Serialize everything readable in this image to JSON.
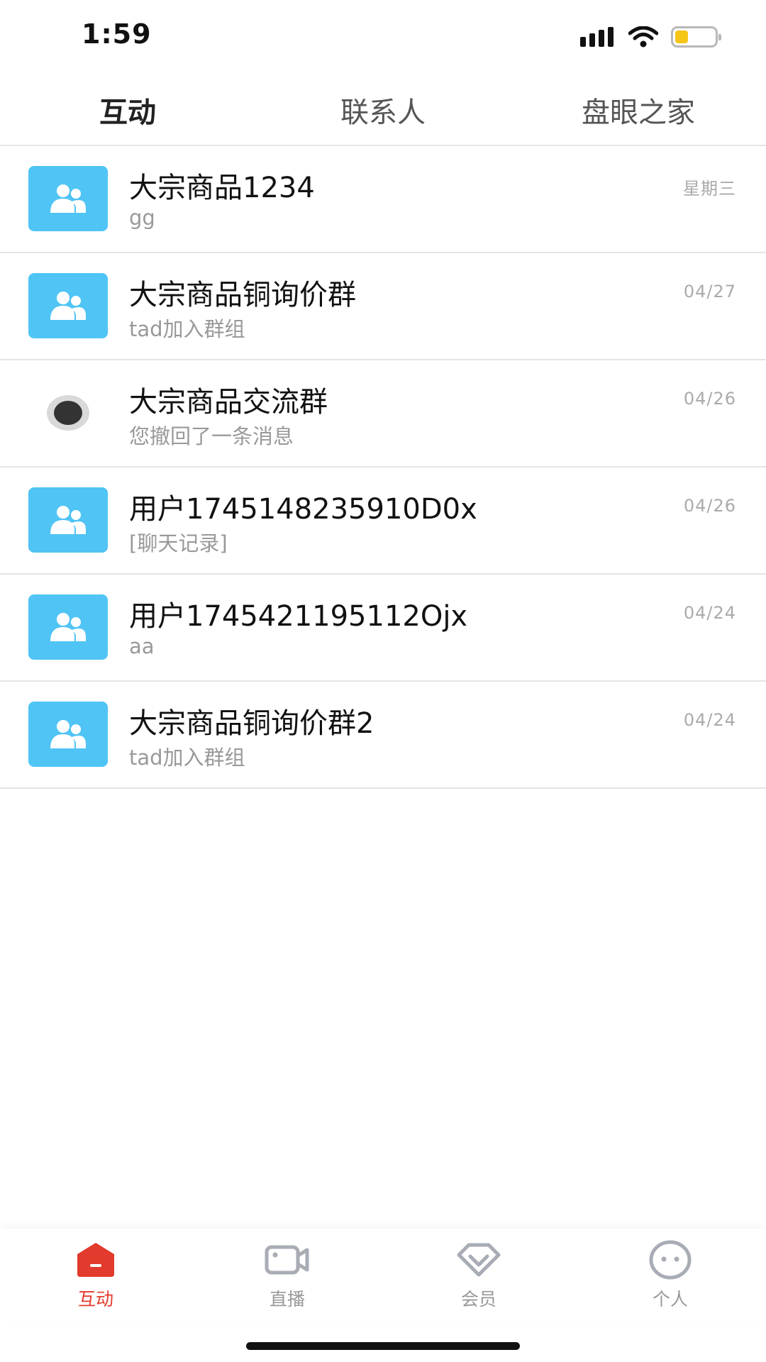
{
  "status_bar": {
    "time": "1:59",
    "battery_level": 0.3,
    "battery_color": "#f5c518"
  },
  "top_tabs": [
    {
      "label": "互动",
      "active": true
    },
    {
      "label": "联系人",
      "active": false
    },
    {
      "label": "盘眼之家",
      "active": false
    }
  ],
  "conversations": [
    {
      "name": "大宗商品1234",
      "preview": "gg",
      "date": "星期三",
      "avatar": "group-icon"
    },
    {
      "name": "大宗商品铜询价群",
      "preview": "tad加入群组",
      "date": "04/27",
      "avatar": "group-icon"
    },
    {
      "name": "大宗商品交流群",
      "preview": "您撤回了一条消息",
      "date": "04/26",
      "avatar": "dot-icon"
    },
    {
      "name": "用户1745148235910D0x",
      "preview": "[聊天记录]",
      "date": "04/26",
      "avatar": "group-icon"
    },
    {
      "name": "用户1745421195112Ojx",
      "preview": "aa",
      "date": "04/24",
      "avatar": "group-icon"
    },
    {
      "name": "大宗商品铜询价群2",
      "preview": "tad加入群组",
      "date": "04/24",
      "avatar": "group-icon"
    }
  ],
  "bottom_nav": [
    {
      "label": "互动",
      "icon": "home-icon",
      "active": true
    },
    {
      "label": "直播",
      "icon": "video-camera-icon",
      "active": false
    },
    {
      "label": "会员",
      "icon": "diamond-icon",
      "active": false
    },
    {
      "label": "个人",
      "icon": "face-icon",
      "active": false
    }
  ],
  "colors": {
    "accent": "#e23a2c",
    "avatar_bg": "#4fc4f5"
  }
}
